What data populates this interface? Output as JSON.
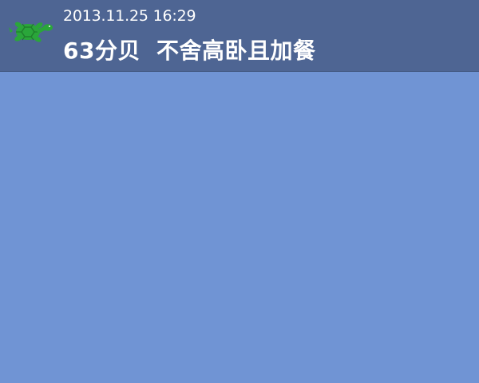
{
  "app": {
    "logo_icon": "turtle-icon",
    "logo_color": "#2aa63a"
  },
  "header": {
    "timestamp": "2013.11.25 16:29",
    "noise_level": "63分贝",
    "status_text": "不舍高卧且加餐"
  },
  "colors": {
    "header_background": "#4e6593",
    "content_background": "#7094d4",
    "text": "#ffffff"
  }
}
